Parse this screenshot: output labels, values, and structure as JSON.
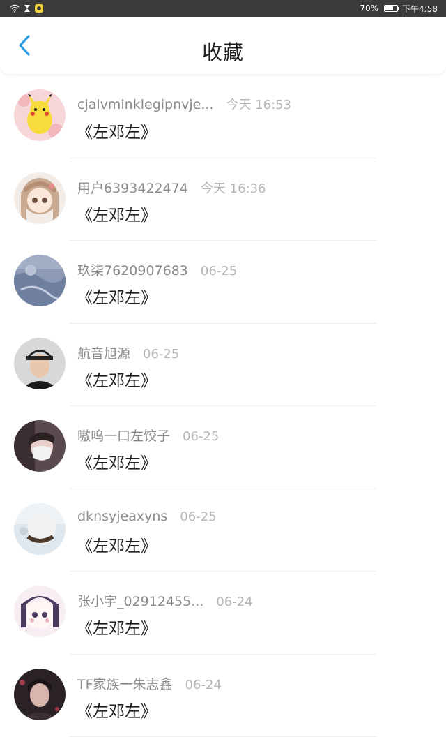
{
  "status_bar": {
    "battery": "70%",
    "time": "下午4:58",
    "battery_level": 0.7
  },
  "header": {
    "title": "收藏",
    "back_icon": "chevron-left-icon",
    "accent": "#2d9be3"
  },
  "items": [
    {
      "username": "cjalvminklegipnvje...",
      "time": "今天 16:53",
      "content": "《左邓左》",
      "avatar": "pikachu"
    },
    {
      "username": "用户6393422474",
      "time": "今天 16:36",
      "content": "《左邓左》",
      "avatar": "anime-girl"
    },
    {
      "username": "玖柒7620907683",
      "time": "06-25",
      "content": "《左邓左》",
      "avatar": "blue-texture"
    },
    {
      "username": "航音旭源",
      "time": "06-25",
      "content": "《左邓左》",
      "avatar": "man-cap"
    },
    {
      "username": "嗷呜一口左饺子",
      "time": "06-25",
      "content": "《左邓左》",
      "avatar": "masked-person"
    },
    {
      "username": "dknsyjeaxyns",
      "time": "06-25",
      "content": "《左邓左》",
      "avatar": "light-photo"
    },
    {
      "username": "张小宇_02912455...",
      "time": "06-24",
      "content": "《左邓左》",
      "avatar": "anime-cartoon"
    },
    {
      "username": "TF家族一朱志鑫",
      "time": "06-24",
      "content": "《左邓左》",
      "avatar": "dark-portrait"
    }
  ]
}
